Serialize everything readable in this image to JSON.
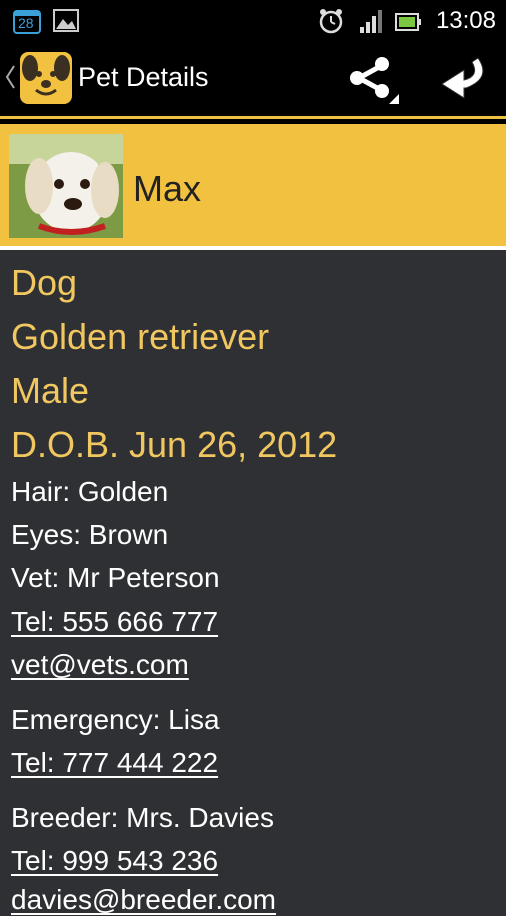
{
  "status_bar": {
    "time": "13:08",
    "calendar_day": "28",
    "icons": [
      "calendar-icon",
      "gallery-icon",
      "alarm-icon",
      "signal-icon",
      "battery-icon"
    ]
  },
  "action_bar": {
    "title": "Pet Details",
    "icons": [
      "back-chevron-icon",
      "app-logo-icon",
      "share-icon",
      "return-icon"
    ]
  },
  "pet": {
    "name": "Max",
    "species": "Dog",
    "breed": "Golden retriever",
    "sex": "Male",
    "dob": "D.O.B. Jun 26, 2012",
    "hair": "Hair: Golden",
    "eyes": "Eyes: Brown",
    "vet": "Vet: Mr Peterson",
    "vet_tel": "Tel: 555 666 777",
    "vet_email": "vet@vets.com",
    "emergency": "Emergency: Lisa",
    "emergency_tel": "Tel: 777 444 222",
    "breeder": "Breeder: Mrs. Davies",
    "breeder_tel": "Tel: 999 543 236",
    "breeder_email": "davies@breeder.com"
  },
  "colors": {
    "accent": "#f1c13f",
    "background": "#2f3034",
    "detail_text": "#f1c75f"
  }
}
